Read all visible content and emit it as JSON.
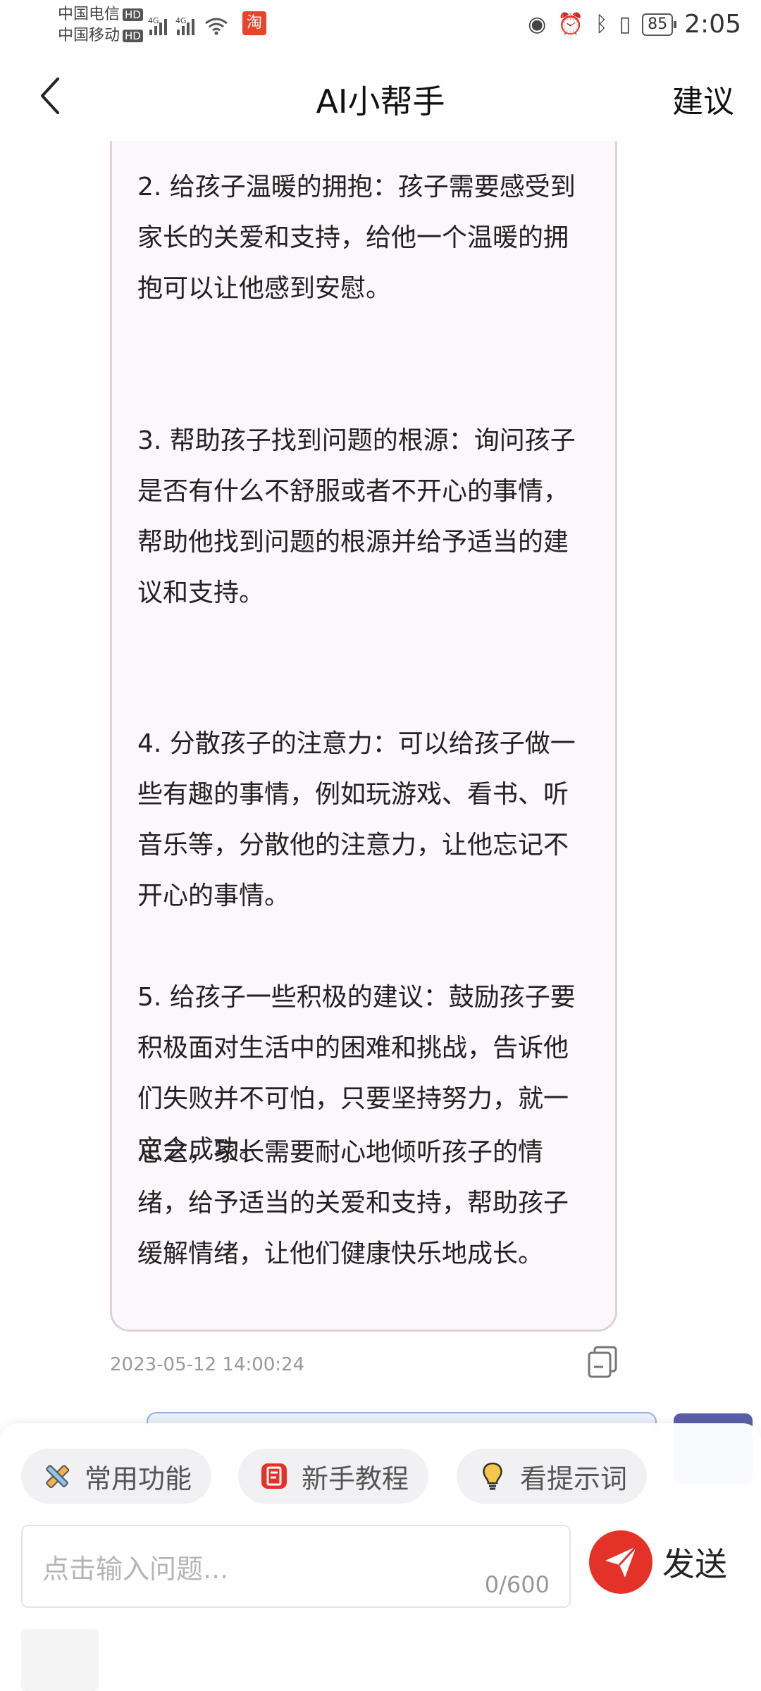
{
  "status_bar": {
    "carrier1": "中国电信",
    "carrier2": "中国移动",
    "hd": "HD",
    "network": "4G",
    "battery": "85",
    "time": "2:05"
  },
  "header": {
    "title": "AI小帮手",
    "right_action": "建议"
  },
  "message": {
    "paragraphs": [
      "2. 给孩子温暖的拥抱：孩子需要感受到家长的关爱和支持，给他一个温暖的拥抱可以让他感到安慰。",
      "3. 帮助孩子找到问题的根源：询问孩子是否有什么不舒服或者不开心的事情，帮助他找到问题的根源并给予适当的建议和支持。",
      "4. 分散孩子的注意力：可以给孩子做一些有趣的事情，例如玩游戏、看书、听音乐等，分散他的注意力，让他忘记不开心的事情。",
      "5. 给孩子一些积极的建议：鼓励孩子要积极面对生活中的困难和挑战，告诉他们失败并不可怕，只要坚持努力，就一定会成功。",
      "总之，家长需要耐心地倾听孩子的情绪，给予适当的关爱和支持，帮助孩子缓解情绪，让他们健康快乐地成长。"
    ],
    "timestamp": "2023-05-12 14:00:24"
  },
  "quick_actions": [
    {
      "label": "常用功能",
      "icon": "pencil-ruler-icon"
    },
    {
      "label": "新手教程",
      "icon": "tutorial-icon"
    },
    {
      "label": "看提示词",
      "icon": "lightbulb-icon"
    }
  ],
  "input": {
    "placeholder": "点击输入问题...",
    "counter": "0/600"
  },
  "send_label": "发送",
  "colors": {
    "accent": "#e53228",
    "bubble_bg": "#fcf7fb",
    "bubble_border": "#dcd2da"
  }
}
